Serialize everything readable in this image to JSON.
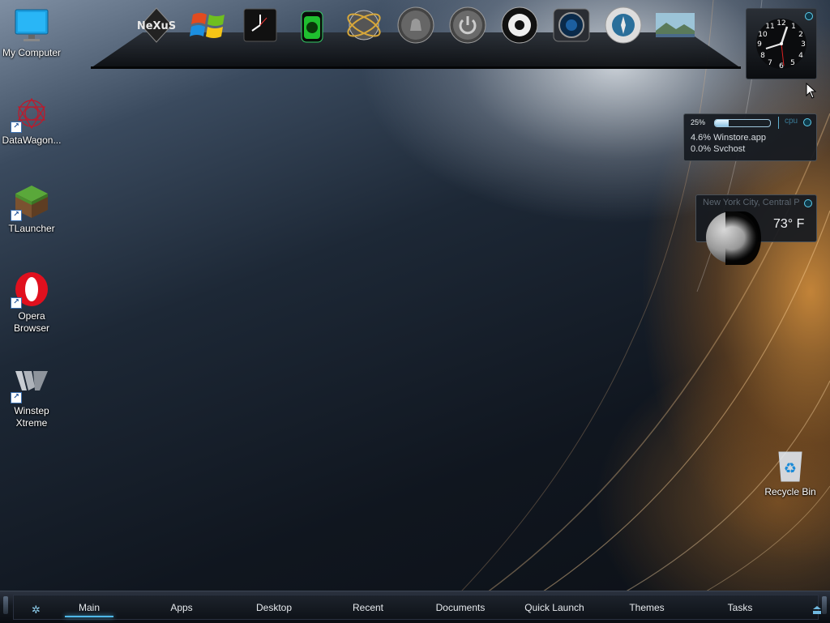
{
  "desktop": {
    "icons": [
      {
        "label": "My Computer"
      },
      {
        "label": "DataWagon..."
      },
      {
        "label": "TLauncher"
      },
      {
        "label": "Opera\nBrowser"
      },
      {
        "label": "Winstep\nXtreme"
      },
      {
        "label": "Recycle Bin"
      }
    ]
  },
  "dock": {
    "items": [
      {
        "icon": "nexus-logo-icon",
        "label": "NeXuS"
      },
      {
        "icon": "windows-flag-icon"
      },
      {
        "icon": "clock-icon"
      },
      {
        "icon": "recycle-biohazard-bin-icon"
      },
      {
        "icon": "globe-network-icon"
      },
      {
        "icon": "bell-icon"
      },
      {
        "icon": "power-icon"
      },
      {
        "icon": "speaker-eyeball-icon"
      },
      {
        "icon": "camera-lens-icon"
      },
      {
        "icon": "compass-browser-icon"
      },
      {
        "icon": "landscape-photo-icon"
      }
    ]
  },
  "clock_widget": {
    "numbers": [
      "12",
      "1",
      "2",
      "3",
      "4",
      "5",
      "6",
      "7",
      "8",
      "9",
      "10",
      "11"
    ]
  },
  "cpu_widget": {
    "percent": "25%",
    "usage": 0.25,
    "label": "cpu",
    "processes": [
      "4.6% Winstore.app",
      "0.0% Svchost"
    ]
  },
  "weather_widget": {
    "location": "New York City, Central P",
    "temperature": "73° F"
  },
  "taskbar": {
    "tabs": [
      "Main",
      "Apps",
      "Desktop",
      "Recent",
      "Documents",
      "Quick Launch",
      "Themes",
      "Tasks"
    ],
    "active_tab": "Main"
  },
  "colors": {
    "accent": "#4fb8e8",
    "cpu_bar": "#9fc7de"
  }
}
